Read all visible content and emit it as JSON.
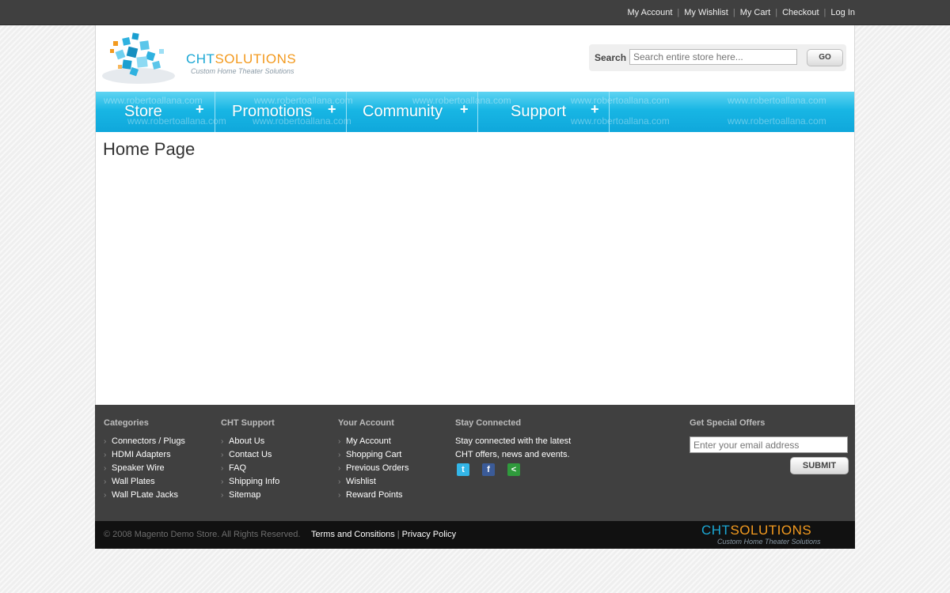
{
  "top_links": [
    "My Account",
    "My Wishlist",
    "My Cart",
    "Checkout",
    "Log In"
  ],
  "brand": {
    "name_part1": "CHT",
    "name_part2": "SOLUTIONS",
    "tagline": "Custom Home Theater Solutions",
    "accent_blue": "#1ba7d4",
    "accent_orange": "#f39a1f"
  },
  "search": {
    "label": "Search",
    "placeholder": "Search entire store here...",
    "button": "GO"
  },
  "nav": {
    "items": [
      "Store",
      "Promotions",
      "Community",
      "Support"
    ],
    "expand_icon": "+",
    "watermark": "www.robertoallana.com",
    "color": "#18b6e4"
  },
  "main": {
    "page_title": "Home Page"
  },
  "footer": {
    "categories": {
      "heading": "Categories",
      "items": [
        "Connectors / Plugs",
        "HDMI Adapters",
        "Speaker Wire",
        "Wall Plates",
        "Wall PLate Jacks"
      ]
    },
    "support": {
      "heading": "CHT Support",
      "items": [
        "About Us",
        "Contact Us",
        "FAQ",
        "Shipping Info",
        "Sitemap"
      ]
    },
    "account": {
      "heading": "Your Account",
      "items": [
        "My Account",
        "Shopping Cart",
        "Previous Orders",
        "Wishlist",
        "Reward Points"
      ]
    },
    "stay_connected": {
      "heading": "Stay Connected",
      "text": "Stay connected with the latest CHT offers, news and events.",
      "icons": [
        "twitter-icon",
        "facebook-icon",
        "share-icon"
      ]
    },
    "offers": {
      "heading": "Get Special Offers",
      "email_placeholder": "Enter your email address",
      "submit": "SUBMIT"
    }
  },
  "bottom": {
    "copyright": "© 2008 Magento Demo Store. All Rights Reserved.",
    "terms": "Terms and Consitions",
    "privacy": "Privacy Policy"
  }
}
